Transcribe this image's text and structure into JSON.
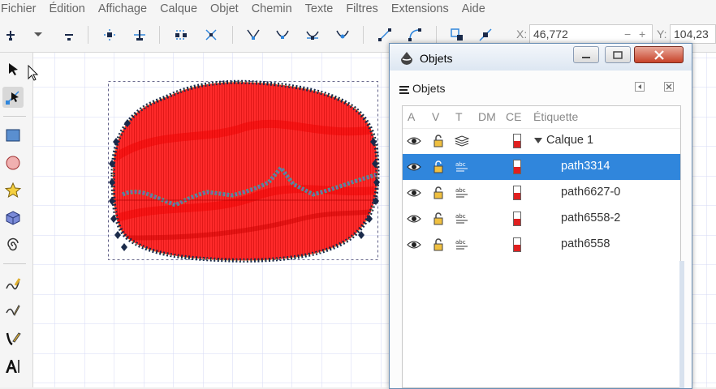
{
  "menubar": [
    "Fichier",
    "Édition",
    "Affichage",
    "Calque",
    "Objet",
    "Chemin",
    "Texte",
    "Filtres",
    "Extensions",
    "Aide"
  ],
  "toolbar": {
    "x_label": "X:",
    "x_value": "46,772",
    "minus": "−",
    "plus": "+",
    "y_label": "Y:",
    "y_value": "104,23"
  },
  "icons": {
    "accent": "#3086dc",
    "path_fill": "#ff2020",
    "handle": "#1a2a4a"
  },
  "dialog": {
    "title": "Objets",
    "panel_title": "Objets",
    "columns": [
      "A",
      "V",
      "T",
      "DM",
      "CE",
      "Étiquette"
    ],
    "rows": [
      {
        "label": "Calque 1",
        "type": "layer",
        "selected": false
      },
      {
        "label": "path3314",
        "type": "path",
        "selected": true
      },
      {
        "label": "path6627-0",
        "type": "path",
        "selected": false
      },
      {
        "label": "path6558-2",
        "type": "path",
        "selected": false
      },
      {
        "label": "path6558",
        "type": "path",
        "selected": false
      }
    ]
  }
}
